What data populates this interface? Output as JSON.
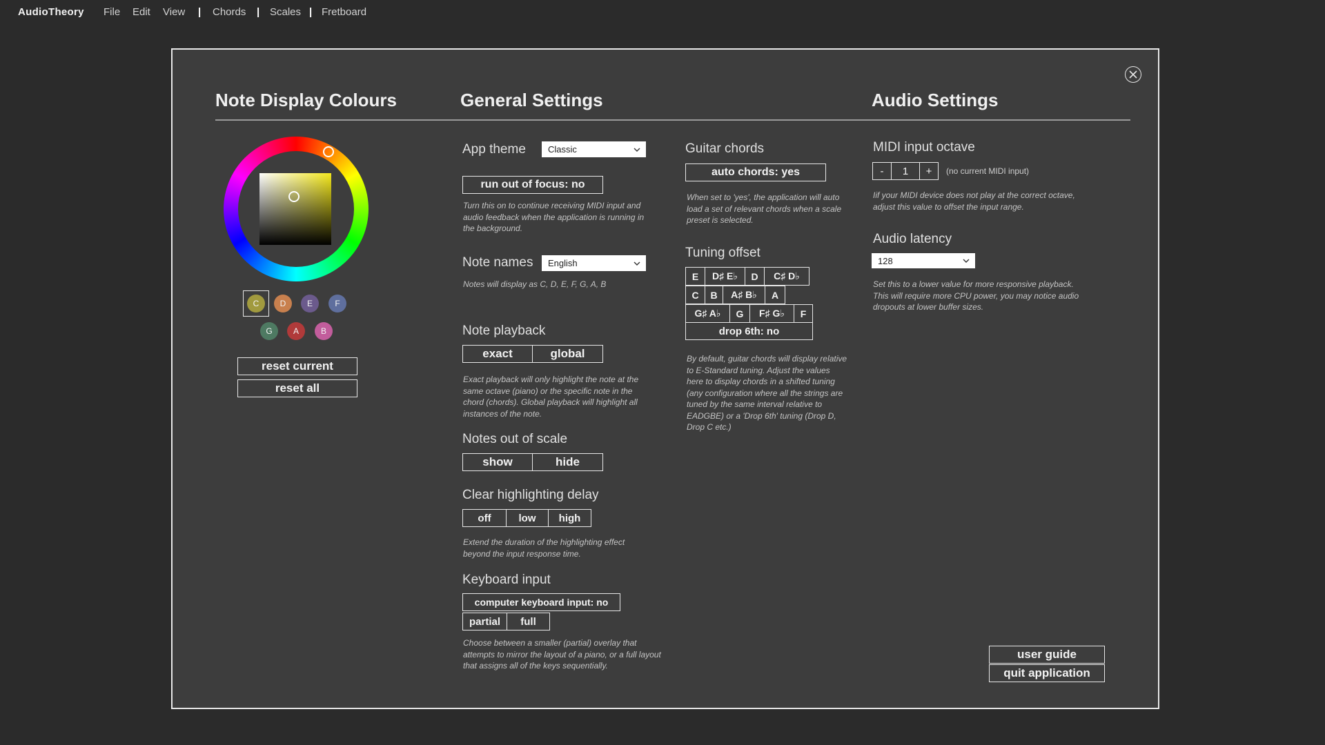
{
  "menu": {
    "brand": "AudioTheory",
    "items": [
      "File",
      "Edit",
      "View"
    ],
    "sep": "|",
    "nav": [
      "Chords",
      "Scales",
      "Fretboard"
    ]
  },
  "sections": {
    "colours": "Note Display Colours",
    "general": "General Settings",
    "audio": "Audio Settings"
  },
  "colours": {
    "swatches": [
      {
        "label": "C",
        "color": "#a19a3e"
      },
      {
        "label": "D",
        "color": "#c8804e"
      },
      {
        "label": "E",
        "color": "#6b5a8c"
      },
      {
        "label": "F",
        "color": "#5f6f9e"
      },
      {
        "label": "G",
        "color": "#4e7a62"
      },
      {
        "label": "A",
        "color": "#b03a3a"
      },
      {
        "label": "B",
        "color": "#c25d9c"
      }
    ],
    "selected": "C",
    "reset_current": "reset current",
    "reset_all": "reset all"
  },
  "general": {
    "app_theme_label": "App theme",
    "app_theme_value": "Classic",
    "focus_button": "run out of focus: no",
    "focus_desc": "Turn this on to continue receiving MIDI input and audio feedback when the application is running in the background.",
    "note_names_label": "Note names",
    "note_names_value": "English",
    "note_names_desc": "Notes will display as C, D, E, F, G, A, B",
    "playback_label": "Note playback",
    "playback_options": [
      "exact",
      "global"
    ],
    "playback_desc": "Exact playback will only highlight the note at the same octave (piano) or the specific note in the chord (chords). Global playback will highlight all instances of the note.",
    "out_of_scale_label": "Notes out of scale",
    "out_of_scale_options": [
      "show",
      "hide"
    ],
    "delay_label": "Clear highlighting delay",
    "delay_options": [
      "off",
      "low",
      "high"
    ],
    "delay_desc": "Extend the duration of the highlighting effect beyond the input response time.",
    "keyboard_label": "Keyboard input",
    "keyboard_button": "computer keyboard input: no",
    "keyboard_options": [
      "partial",
      "full"
    ],
    "keyboard_desc": "Choose between a smaller (partial) overlay that attempts to mirror the layout of a piano, or a full layout that assigns all of the keys sequentially."
  },
  "guitar": {
    "chords_label": "Guitar chords",
    "auto_button": "auto chords: yes",
    "auto_desc": "When set to 'yes', the application will auto load a set of relevant chords when a scale preset is selected.",
    "tuning_label": "Tuning offset",
    "row1": [
      "E",
      "D♯ E♭",
      "D",
      "C♯ D♭"
    ],
    "row2": [
      "C",
      "B",
      "A♯ B♭",
      "A"
    ],
    "row3": [
      "G♯ A♭",
      "G",
      "F♯ G♭",
      "F"
    ],
    "drop_button": "drop 6th: no",
    "tuning_desc": "By default, guitar chords will display relative to E-Standard tuning. Adjust the values here to display chords in a shifted tuning (any configuration where all the strings are tuned by the same interval relative to EADGBE) or a 'Drop 6th' tuning (Drop D, Drop C etc.)"
  },
  "audio": {
    "midi_label": "MIDI input octave",
    "minus": "-",
    "octave_value": "1",
    "plus": "+",
    "midi_status": "(no current MIDI input)",
    "midi_desc": "Iif your MIDI device does not play at the correct octave, adjust this value to offset the input range.",
    "latency_label": "Audio latency",
    "latency_value": "128",
    "latency_desc": "Set this to a lower value for more responsive playback. This will require more CPU power, you may notice audio dropouts at lower buffer sizes.",
    "user_guide": "user guide",
    "quit": "quit application"
  },
  "icons": {
    "close": "close-icon",
    "chevron": "chevron-down-icon"
  }
}
